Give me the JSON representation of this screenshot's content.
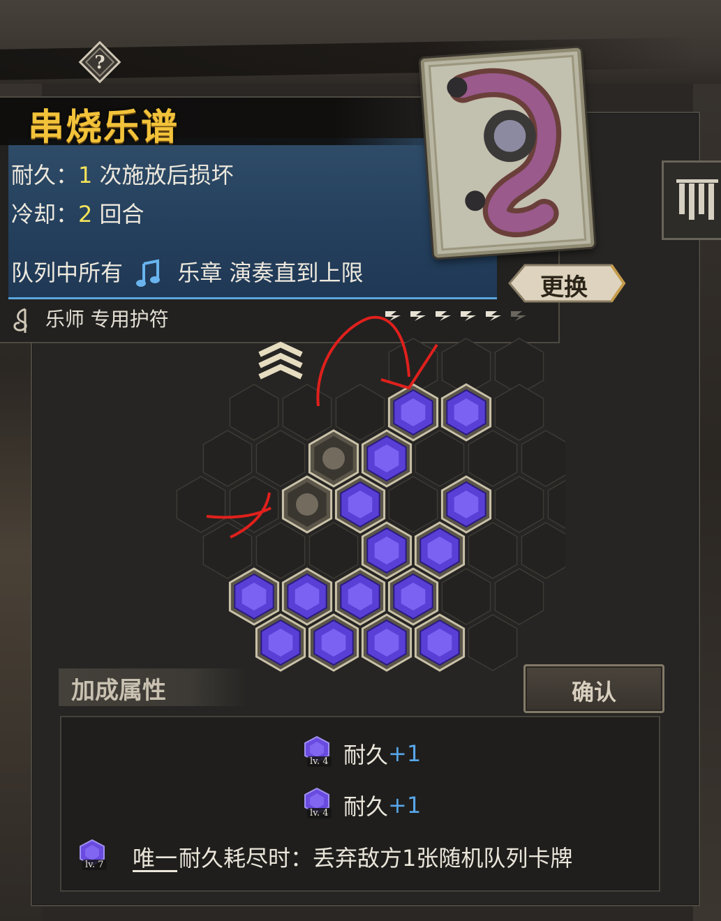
{
  "item": {
    "title": "串烧乐谱",
    "durability_label": "耐久：",
    "durability_value": "1",
    "durability_suffix": "次施放后损坏",
    "cooldown_label": "冷却：",
    "cooldown_value": "2",
    "cooldown_suffix": "回合",
    "effect_prefix": "队列中所有",
    "effect_keyword": "乐章",
    "effect_suffix": "演奏直到上限",
    "class_text": "乐师 专用护符",
    "pips_filled": 5,
    "pips_total": 6
  },
  "buttons": {
    "swap": "更换",
    "confirm": "确认"
  },
  "section": {
    "bonus_title": "加成属性"
  },
  "bonuses": [
    {
      "level": "lv. 4",
      "stat": "耐久",
      "value": "+1"
    },
    {
      "level": "lv. 4",
      "stat": "耐久",
      "value": "+1"
    },
    {
      "level": "lv. 7",
      "tag": "唯一",
      "text": "耐久耗尽时：丢弃敌方1张随机队列卡牌"
    }
  ],
  "colors": {
    "title_gold": "#f2c23a",
    "value_yellow": "#f4e45a",
    "plus_blue": "#58a7ea",
    "gem_purple": "#6a4be0",
    "annotation_red": "#e0201c"
  },
  "icons": [
    "help-icon",
    "music-note-icon",
    "clef-icon",
    "rank-chevron-icon",
    "gem-icon",
    "side-menu-icon"
  ]
}
